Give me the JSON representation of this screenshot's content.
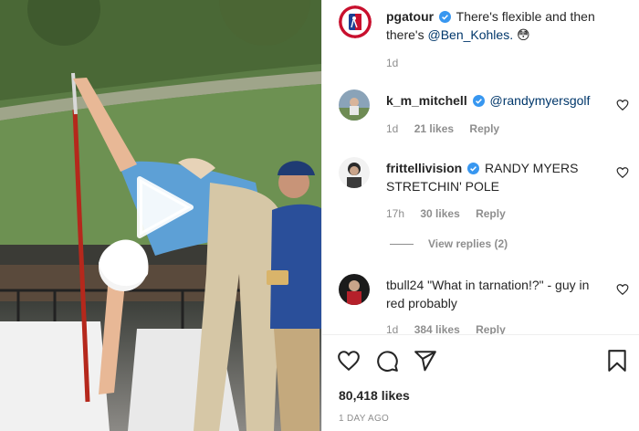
{
  "post": {
    "username": "pgatour",
    "caption_text": "There's flexible and then there's",
    "caption_mention": "@Ben_Kohles.",
    "caption_emoji": "😳",
    "time": "1d"
  },
  "comments": [
    {
      "username": "k_m_mitchell",
      "mention": "@randymyersgolf",
      "text": "",
      "time": "1d",
      "likes": "21 likes",
      "reply": "Reply"
    },
    {
      "username": "frittellivision",
      "mention": "",
      "text": "RANDY MYERS STRETCHIN' POLE",
      "time": "17h",
      "likes": "30 likes",
      "reply": "Reply"
    },
    {
      "username": "tbull24",
      "mention": "",
      "text": "\"What in tarnation!?\" - guy in red probably",
      "time": "1d",
      "likes": "384 likes",
      "reply": "Reply"
    }
  ],
  "view_replies": "View replies (2)",
  "actions": {
    "like_icon": "heart-icon",
    "comment_icon": "comment-icon",
    "share_icon": "share-icon",
    "save_icon": "bookmark-icon"
  },
  "likes_count": "80,418 likes",
  "posted_ago": "1 DAY AGO",
  "colors": {
    "verified": "#3897f0",
    "mention": "#00376b",
    "muted": "#8e8e8e",
    "pga_red": "#c8102e",
    "pga_blue": "#1c3f94"
  }
}
